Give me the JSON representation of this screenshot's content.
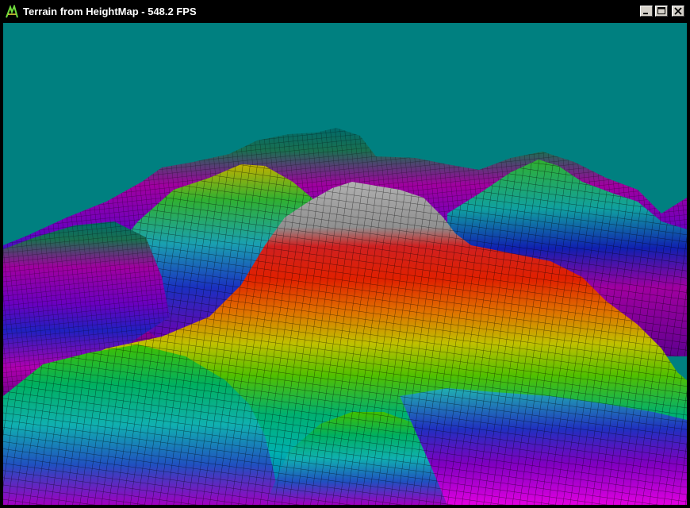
{
  "window": {
    "title": "Terrain from HeightMap - 548.2 FPS",
    "icon": "opengl-app-icon",
    "controls": {
      "minimize": "minimize-icon",
      "maximize": "maximize-icon",
      "close": "close-icon"
    }
  },
  "scene": {
    "background_color": "#008080",
    "render_style": "wireframe-over-colored-heightmap",
    "color_bands": [
      "#ff00ff",
      "#0000ff",
      "#00ffff",
      "#00ff00",
      "#ffff00",
      "#ff0000",
      "#c0c0c0"
    ]
  }
}
